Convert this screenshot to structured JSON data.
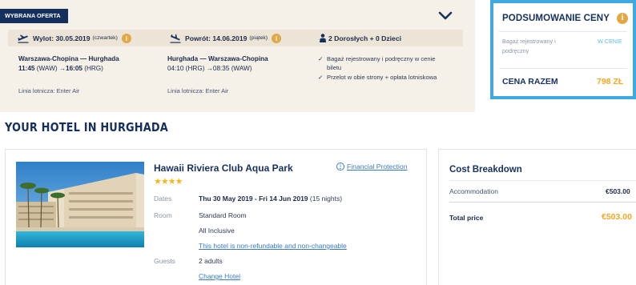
{
  "offer": {
    "badge": "WYBRANA OFERTA",
    "outbound": {
      "label": "Wylot: 30.05.2019",
      "day": "(czwartek)"
    },
    "return": {
      "label": "Powrót: 14.06.2019",
      "day": "(piątek)"
    },
    "passengers": "2 Dorosłych + 0 Dzieci",
    "outbound_flight": {
      "route": "Warszawa-Chopina — Hurghada",
      "dep_time": "11:45",
      "dep_code": "(WAW)",
      "arr_time": "16:05",
      "arr_code": "(HRG)",
      "airline": "Linia lotnicza: Enter Air"
    },
    "return_flight": {
      "route": "Hurghada — Warszawa-Chopina",
      "dep_time": "04:10",
      "dep_code": "(HRG)",
      "arr_time": "08:35",
      "arr_code": "(WAW)",
      "airline": "Linia lotnicza: Enter Air"
    },
    "included": [
      "Bagaż rejestrowany i podręczny w cenie biletu",
      "Przelot w obie strony + opłata lotniskowa"
    ]
  },
  "summary": {
    "title": "PODSUMOWANIE CENY",
    "baggage_label": "Bagaż rejestrowany i podręczny",
    "baggage_value": "W CENIE",
    "total_label": "CENA RAZEM",
    "total_value": "798 ZŁ"
  },
  "section_title": "YOUR HOTEL IN HURGHADA",
  "hotel": {
    "name": "Hawaii Riviera Club Aqua Park",
    "financial_protection": "Financial Protection",
    "stars": "★★★★",
    "dates_label": "Dates",
    "dates_value": "Thu 30 May 2019 - Fri 14 Jun 2019",
    "nights": "(15 nights)",
    "room_label": "Room",
    "room_value": "Standard Room",
    "board": "All Inclusive",
    "refund_note": "This hotel is non-refundable and non-changeable",
    "guests_label": "Guests",
    "guests_value": "2 adults",
    "change_hotel": "Change Hotel"
  },
  "cost": {
    "title": "Cost Breakdown",
    "accommodation_label": "Accommodation",
    "accommodation_value": "€503.00",
    "total_label": "Total price",
    "total_value": "€503.00"
  },
  "colors": {
    "navy": "#16305e",
    "accent_blue": "#3fa9e0",
    "orange": "#f5a623",
    "panel_beige": "#f5f0e8"
  }
}
